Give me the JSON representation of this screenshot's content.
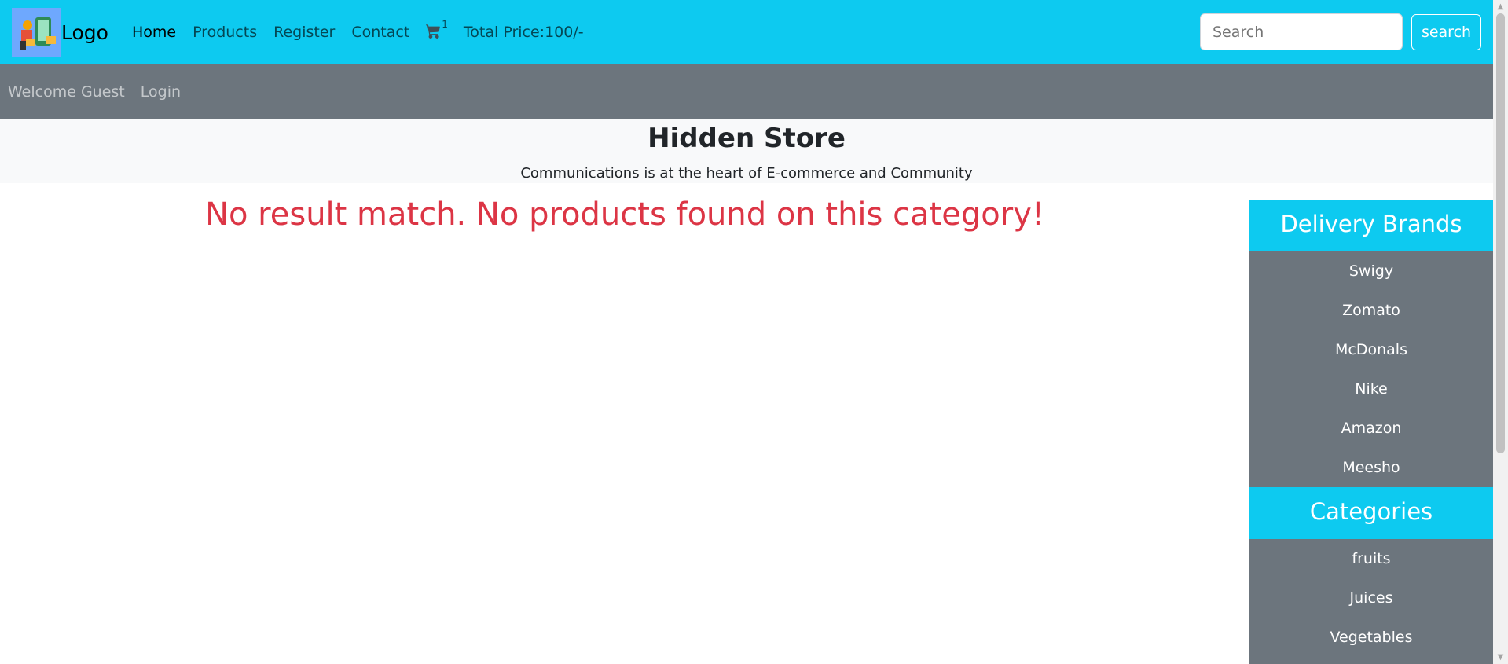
{
  "brand": {
    "label": "Logo"
  },
  "nav": {
    "items": [
      {
        "label": "Home",
        "active": true
      },
      {
        "label": "Products"
      },
      {
        "label": "Register"
      },
      {
        "label": "Contact"
      }
    ],
    "cart_count": "1",
    "total_price": "Total Price:100/-"
  },
  "search": {
    "placeholder": "Search",
    "button_label": "search"
  },
  "subnav": {
    "welcome": "Welcome Guest",
    "login": "Login"
  },
  "hero": {
    "title": "Hidden Store",
    "subtitle": "Communications is at the heart of E-commerce and Community"
  },
  "message": "No result match. No products found on this category!",
  "sidebar": {
    "brands_title": "Delivery Brands",
    "brands": [
      "Swigy",
      "Zomato",
      "McDonals",
      "Nike",
      "Amazon",
      "Meesho"
    ],
    "categories_title": "Categories",
    "categories": [
      "fruits",
      "Juices",
      "Vegetables"
    ]
  },
  "colors": {
    "primary": "#0dcaf0",
    "secondary": "#6c757d",
    "danger": "#dc3545",
    "light": "#f8f9fa"
  }
}
